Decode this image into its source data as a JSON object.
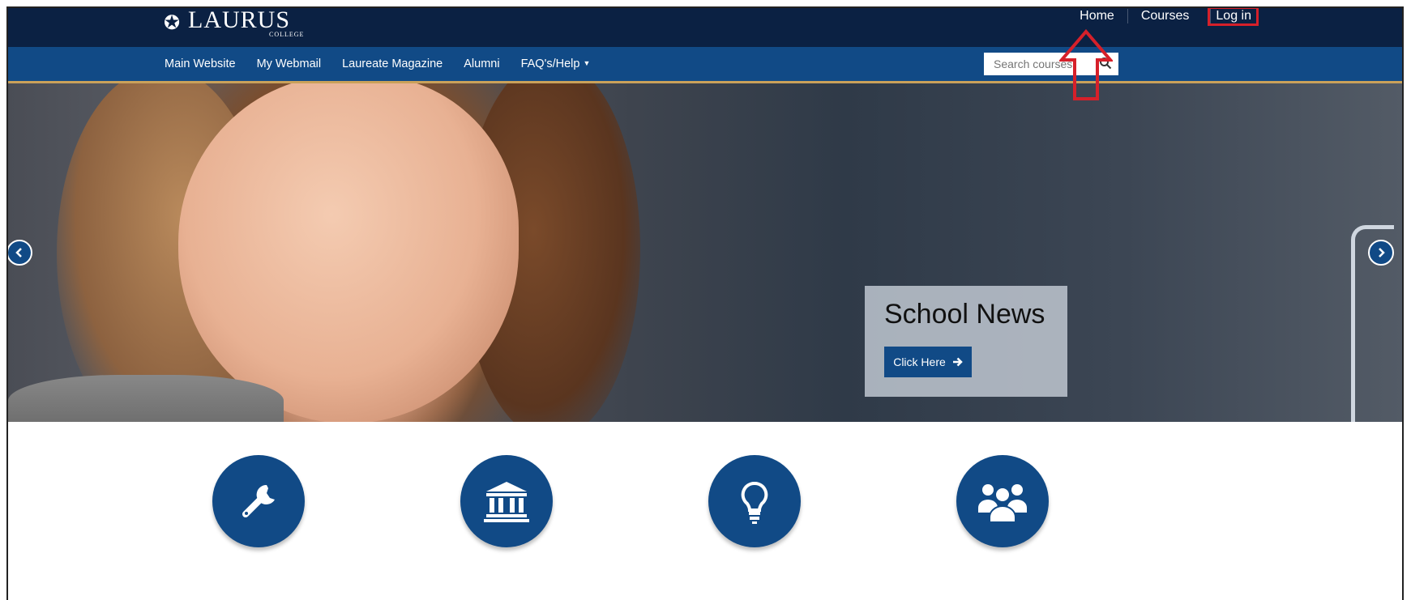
{
  "brand": {
    "logo_text": "LAURUS",
    "logo_subtext": "COLLEGE",
    "logo_mark_icon": "globe-crest-icon"
  },
  "top_nav": {
    "items": [
      {
        "label": "Home"
      },
      {
        "label": "Courses"
      },
      {
        "label": "Log in"
      }
    ]
  },
  "main_nav": {
    "items": [
      {
        "label": "Main Website"
      },
      {
        "label": "My Webmail"
      },
      {
        "label": "Laureate Magazine"
      },
      {
        "label": "Alumni"
      },
      {
        "label": "FAQ's/Help"
      }
    ],
    "search": {
      "placeholder": "Search courses"
    }
  },
  "hero": {
    "caption_title": "School News",
    "cta_label": "Click Here",
    "prev_icon": "chevron-left-icon",
    "next_icon": "chevron-right-icon"
  },
  "features": [
    {
      "icon": "wrench-icon"
    },
    {
      "icon": "institution-icon"
    },
    {
      "icon": "lightbulb-icon"
    },
    {
      "icon": "group-icon"
    }
  ],
  "colors": {
    "topbar": "#0b2143",
    "nav": "#114a86",
    "accent_line": "#caa15a",
    "annotation": "#d6202a"
  }
}
